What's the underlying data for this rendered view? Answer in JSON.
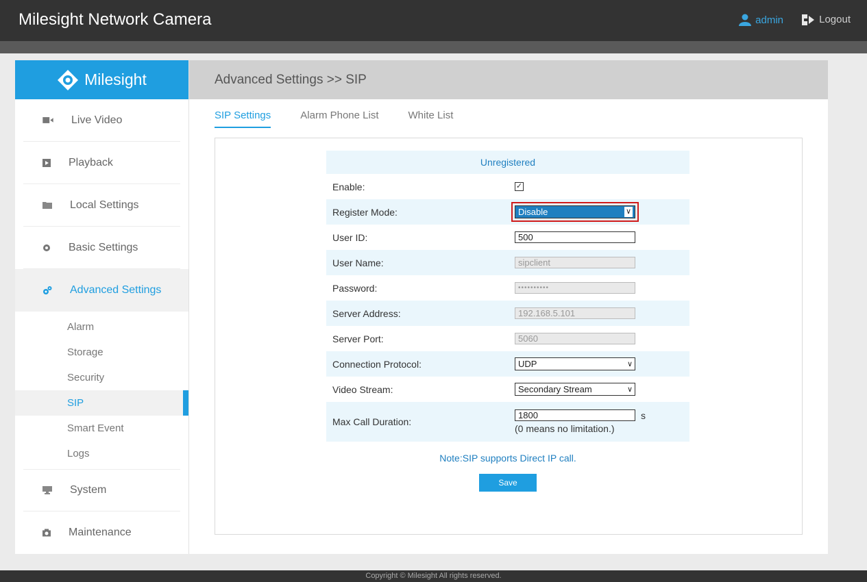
{
  "header": {
    "title": "Milesight Network Camera",
    "user": "admin",
    "logout": "Logout"
  },
  "brand": "Milesight",
  "sidebar": {
    "items": [
      {
        "label": "Live Video",
        "icon": "video-icon"
      },
      {
        "label": "Playback",
        "icon": "playback-icon"
      },
      {
        "label": "Local Settings",
        "icon": "folder-icon"
      },
      {
        "label": "Basic Settings",
        "icon": "gear-icon"
      },
      {
        "label": "Advanced Settings",
        "icon": "advanced-gears-icon"
      },
      {
        "label": "System",
        "icon": "monitor-icon"
      },
      {
        "label": "Maintenance",
        "icon": "camera-icon"
      }
    ],
    "subitems": [
      "Alarm",
      "Storage",
      "Security",
      "SIP",
      "Smart Event",
      "Logs"
    ]
  },
  "breadcrumb": "Advanced Settings >> SIP",
  "tabs": [
    "SIP Settings",
    "Alarm Phone List",
    "White List"
  ],
  "form": {
    "status": "Unregistered",
    "enable_label": "Enable:",
    "enable_checked": "✓",
    "register_mode_label": "Register Mode:",
    "register_mode_value": "Disable",
    "user_id_label": "User ID:",
    "user_id_value": "500",
    "user_name_label": "User Name:",
    "user_name_value": "sipclient",
    "password_label": "Password:",
    "password_value": "••••••••••",
    "server_address_label": "Server Address:",
    "server_address_value": "192.168.5.101",
    "server_port_label": "Server Port:",
    "server_port_value": "5060",
    "protocol_label": "Connection Protocol:",
    "protocol_value": "UDP",
    "stream_label": "Video Stream:",
    "stream_value": "Secondary Stream",
    "max_call_label": "Max Call Duration:",
    "max_call_value": "1800",
    "max_call_unit": "s",
    "max_call_hint": "(0 means no limitation.)"
  },
  "note": "Note:SIP supports Direct IP call.",
  "save_label": "Save",
  "footer": "Copyright © Milesight All rights reserved.",
  "colors": {
    "accent": "#1f9ee0",
    "topbar": "#333333",
    "highlight_border": "#d01a1a"
  }
}
